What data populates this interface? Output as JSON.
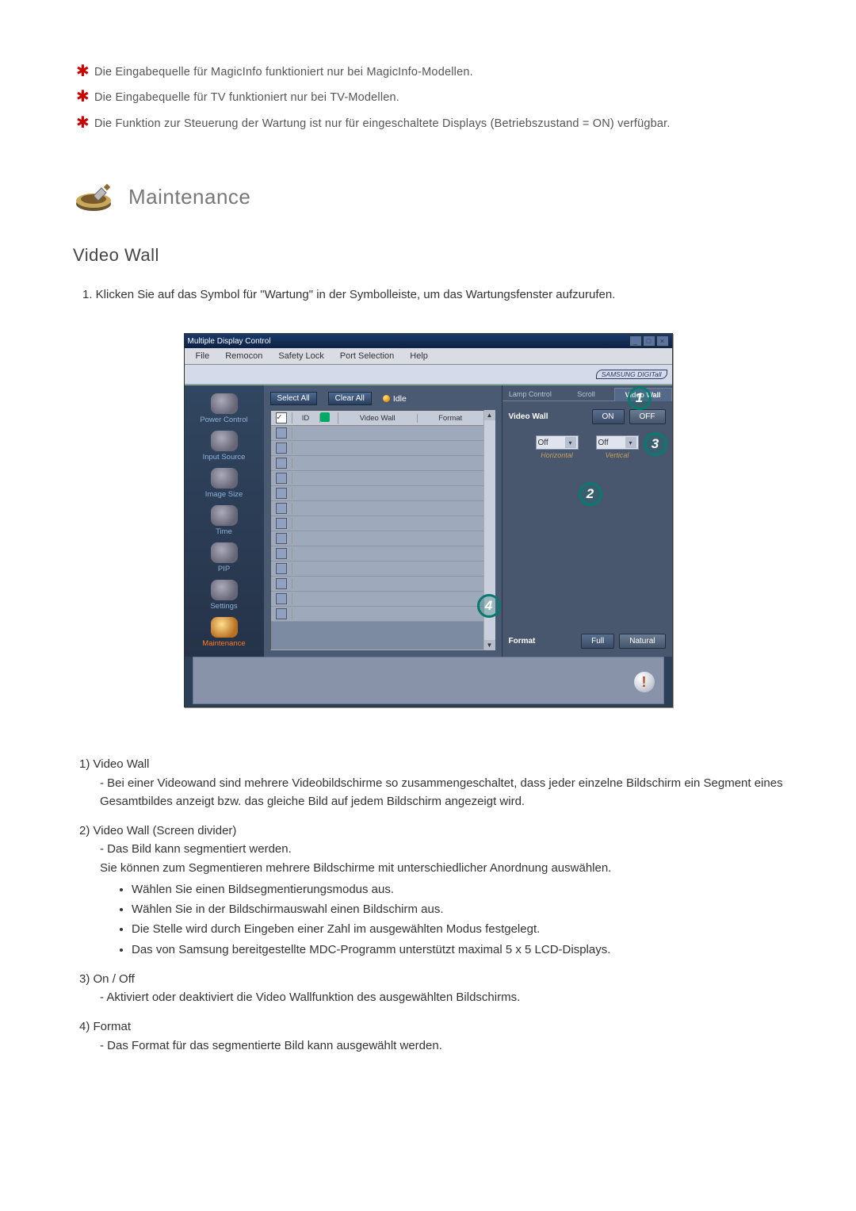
{
  "notes": [
    "Die Eingabequelle für MagicInfo funktioniert nur bei MagicInfo-Modellen.",
    "Die Eingabequelle für TV funktioniert nur bei TV-Modellen.",
    "Die Funktion zur Steuerung der Wartung ist nur für eingeschaltete Displays (Betriebszustand = ON) verfügbar."
  ],
  "section_title": "Maintenance",
  "heading": "Video Wall",
  "step1": "1.  Klicken Sie auf das Symbol für \"Wartung\" in der Symbolleiste, um das Wartungsfenster aufzurufen.",
  "app": {
    "title": "Multiple Display Control",
    "menu": [
      "File",
      "Remocon",
      "Safety Lock",
      "Port Selection",
      "Help"
    ],
    "brand": "SAMSUNG DIGITall",
    "sidebar": [
      {
        "label": "Power Control",
        "active": false
      },
      {
        "label": "Input Source",
        "active": false
      },
      {
        "label": "Image Size",
        "active": false
      },
      {
        "label": "Time",
        "active": false
      },
      {
        "label": "PIP",
        "active": false
      },
      {
        "label": "Settings",
        "active": false
      },
      {
        "label": "Maintenance",
        "active": true
      }
    ],
    "toolbar": {
      "select_all": "Select All",
      "clear_all": "Clear All",
      "idle": "Idle"
    },
    "grid": {
      "col_id": "ID",
      "col_vw": "Video Wall",
      "col_fmt": "Format"
    },
    "tabs": [
      {
        "label": "Lamp Control",
        "active": false
      },
      {
        "label": "Scroll",
        "active": false
      },
      {
        "label": "Video Wall",
        "active": true
      }
    ],
    "panel": {
      "row1_label": "Video Wall",
      "on": "ON",
      "off": "OFF",
      "sel_h": "Off",
      "sel_v": "Off",
      "lab_h": "Horizontal",
      "lab_v": "Vertical",
      "row2_label": "Format",
      "full": "Full",
      "natural": "Natural"
    }
  },
  "callouts": {
    "c1": "1",
    "c2": "2",
    "c3": "3",
    "c4": "4"
  },
  "descriptions": {
    "d1": {
      "num": "1)",
      "title": "Video Wall",
      "lines": [
        "- Bei einer Videowand sind mehrere Videobildschirme so zusammengeschaltet, dass jeder einzelne Bildschirm ein Segment eines Gesamtbildes anzeigt bzw. das gleiche Bild auf jedem Bildschirm angezeigt wird."
      ]
    },
    "d2": {
      "num": "2)",
      "title": "Video Wall (Screen divider)",
      "lines": [
        "- Das Bild kann segmentiert werden.",
        "Sie können zum Segmentieren mehrere Bildschirme mit unterschiedlicher Anordnung auswählen."
      ],
      "bullets": [
        "Wählen Sie einen Bildsegmentierungsmodus aus.",
        "Wählen Sie in der Bildschirmauswahl einen Bildschirm aus.",
        "Die Stelle wird durch Eingeben einer Zahl im ausgewählten Modus festgelegt.",
        "Das von Samsung bereitgestellte MDC-Programm unterstützt maximal 5 x 5 LCD-Displays."
      ]
    },
    "d3": {
      "num": "3)",
      "title": "On / Off",
      "lines": [
        "- Aktiviert oder deaktiviert die Video Wallfunktion des ausgewählten Bildschirms."
      ]
    },
    "d4": {
      "num": "4)",
      "title": "Format",
      "lines": [
        "- Das Format für das segmentierte Bild kann ausgewählt werden."
      ]
    }
  }
}
